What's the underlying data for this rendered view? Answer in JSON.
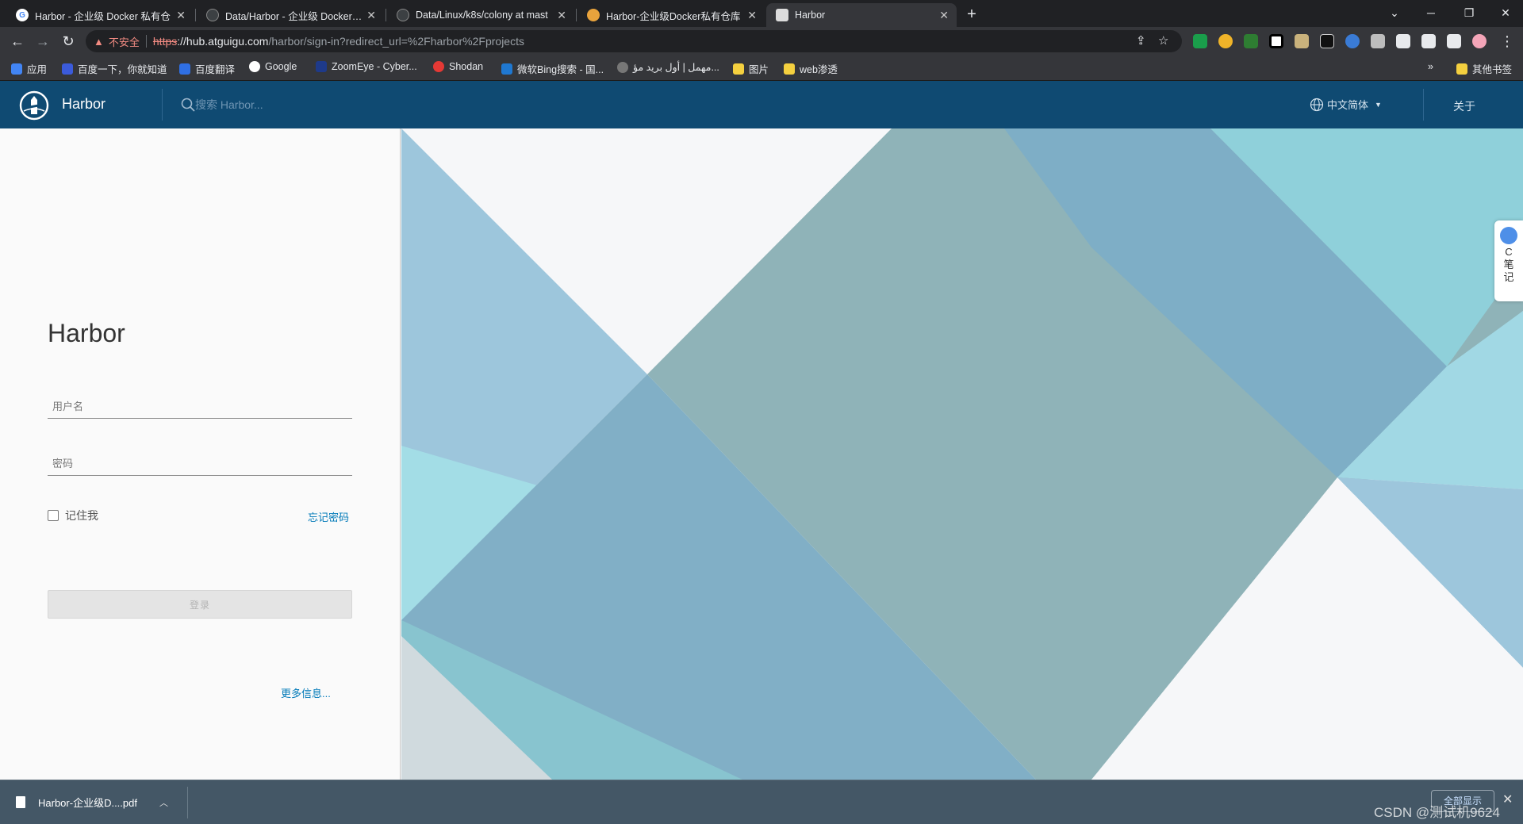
{
  "browser": {
    "tabs": [
      {
        "title": "Harbor - 企业级 Docker 私有仓",
        "color": "#4285f4",
        "letter": "G"
      },
      {
        "title": "Data/Harbor - 企业级 Docker 私",
        "color": "#5f6368",
        "letter": ""
      },
      {
        "title": "Data/Linux/k8s/colony at mast",
        "color": "#5f6368",
        "letter": ""
      },
      {
        "title": "Harbor-企业级Docker私有仓库",
        "color": "#e8a33c",
        "letter": ""
      },
      {
        "title": "Harbor",
        "color": "#9aa0a6",
        "letter": ""
      }
    ],
    "url": {
      "security_label": "不安全",
      "scheme": "https",
      "host": "://hub.atguigu.com",
      "path": "/harbor/sign-in?redirect_url=%2Fharbor%2Fprojects"
    },
    "bookmarks": [
      {
        "label": "应用",
        "color": "#4285f4"
      },
      {
        "label": "百度一下，你就知道",
        "color": "#3b5bdb"
      },
      {
        "label": "百度翻译",
        "color": "#2f6fe4"
      },
      {
        "label": "Google",
        "color": "#ffffff"
      },
      {
        "label": "ZoomEye - Cyber...",
        "color": "#1e3a8a"
      },
      {
        "label": "Shodan",
        "color": "#e53935"
      },
      {
        "label": "微软Bing搜索 - 国...",
        "color": "#1f78d1"
      },
      {
        "label": "مهمل | أول بريد مؤ...",
        "color": "#777777"
      },
      {
        "label": "图片",
        "color": "#f4d03f"
      },
      {
        "label": "web渗透",
        "color": "#f4d03f"
      }
    ],
    "other_bookmarks": "其他书签"
  },
  "header": {
    "brand": "Harbor",
    "search_placeholder": "搜索 Harbor...",
    "language": "中文简体",
    "about": "关于"
  },
  "login": {
    "title": "Harbor",
    "username_placeholder": "用户名",
    "password_placeholder": "密码",
    "remember_me": "记住我",
    "forgot_password": "忘记密码",
    "login_button": "登录",
    "more_info": "更多信息..."
  },
  "side_widget": {
    "label": "C笔记"
  },
  "downloads": {
    "file": "Harbor-企业级D....pdf",
    "show_all": "全部显示",
    "watermark": "CSDN @测试机9624"
  },
  "colors": {
    "header_bg": "#0f4a72",
    "link": "#0079b8",
    "download_bar": "#445766"
  }
}
